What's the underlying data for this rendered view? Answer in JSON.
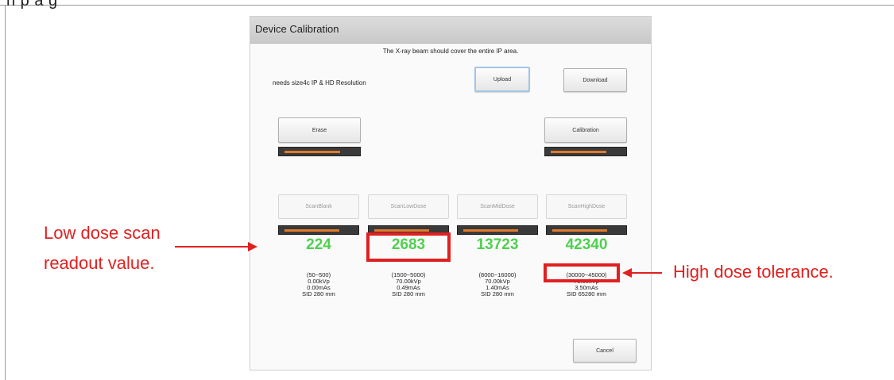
{
  "page_top_text": "n      p                                    a                          g",
  "dialog": {
    "title": "Device Calibration",
    "hint": "The X-ray beam should cover the entire IP area.",
    "needs": "needs  size4c IP  & HD Resolution",
    "upload_label": "Upload",
    "download_label": "Download",
    "erase_label": "Erase",
    "calibration_label": "Calibration",
    "cancel_label": "Cancel",
    "erase_progress": 0.8,
    "calibration_progress": 0.8,
    "scans": [
      {
        "label": "ScanBlank",
        "value": "224",
        "range": "(50~500)",
        "kvp": "0.00kVp",
        "mas": "0.00mAs",
        "sid": "SID 280 mm",
        "progress": 0.8
      },
      {
        "label": "ScanLowDose",
        "value": "2683",
        "range": "(1500~5000)",
        "kvp": "70.00kVp",
        "mas": "0.49mAs",
        "sid": "SID 280 mm",
        "progress": 0.8
      },
      {
        "label": "ScanMidDose",
        "value": "13723",
        "range": "(8000~16000)",
        "kvp": "70.00kVp",
        "mas": "1.40mAs",
        "sid": "SID 280 mm",
        "progress": 0.8
      },
      {
        "label": "ScanHighDose",
        "value": "42340",
        "range": "(30000~45000)",
        "kvp": "70.00kVp",
        "mas": "3.50mAs",
        "sid": "SID 65280 mm",
        "progress": 0.8
      }
    ]
  },
  "annotations": {
    "low_dose_line1": "Low dose scan",
    "low_dose_line2": "readout value.",
    "high_dose": "High dose tolerance."
  },
  "colors": {
    "annotation_red": "#e02020",
    "readout_green": "#4fd04f",
    "progress_orange": "#e27a2a"
  }
}
